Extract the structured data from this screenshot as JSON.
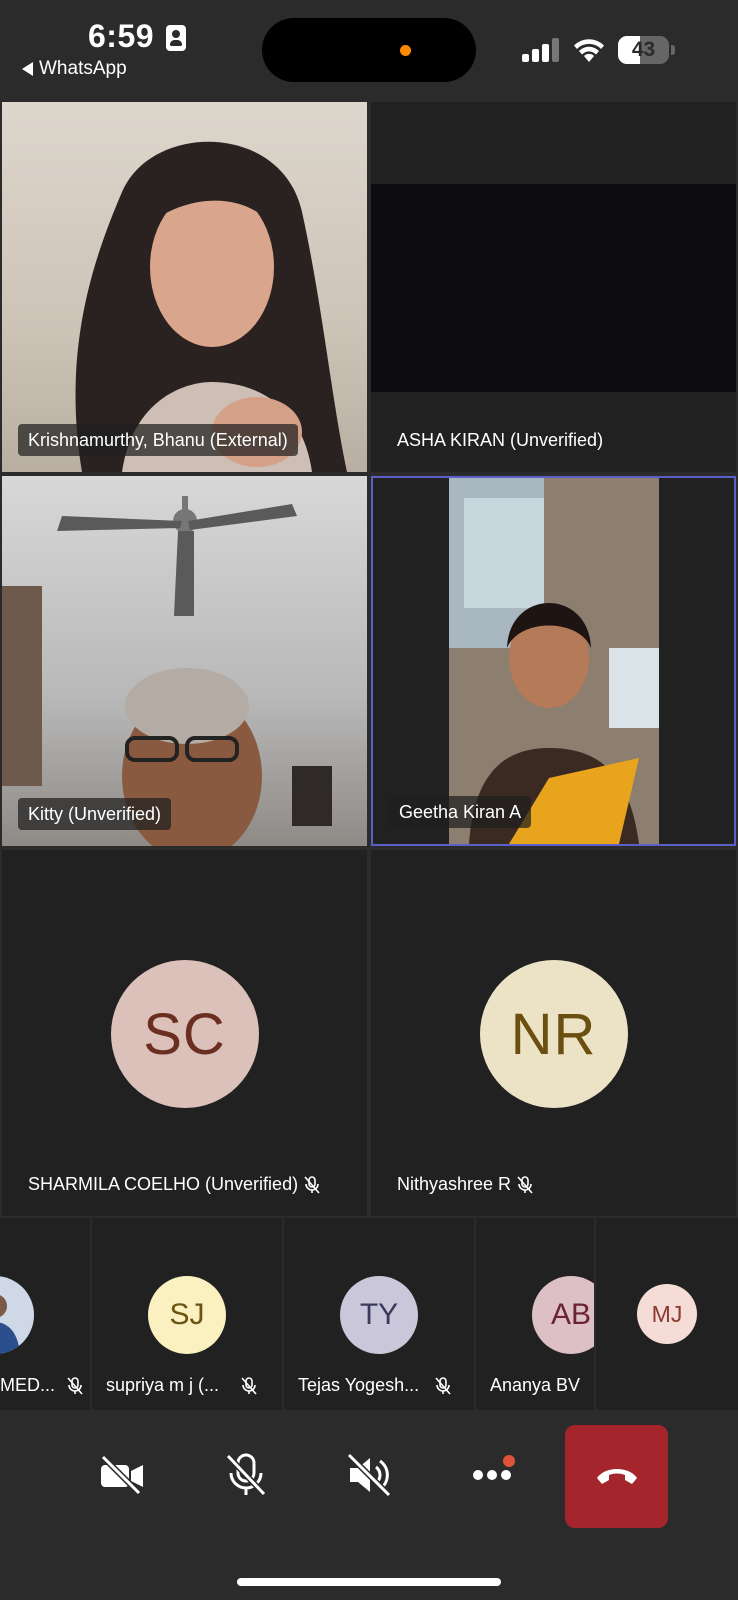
{
  "status_bar": {
    "time": "6:59",
    "back_label": "WhatsApp",
    "battery": "43",
    "battery_level": 0.43
  },
  "grid": [
    {
      "name": "Krishnamurthy, Bhanu (External)",
      "video": true
    },
    {
      "name": "ASHA KIRAN (Unverified)",
      "video": false
    },
    {
      "name": "Kitty (Unverified)",
      "video": true
    },
    {
      "name": "Geetha Kiran A",
      "video": true,
      "active": true
    },
    {
      "name": "SHARMILA COELHO (Unverified)",
      "initials": "SC",
      "muted": true,
      "avatar_bg": "#dcc0ba",
      "avatar_fg": "#6b2f22"
    },
    {
      "name": "Nithyashree R",
      "initials": "NR",
      "muted": true,
      "avatar_bg": "#ece3c6",
      "avatar_fg": "#6b4f10"
    }
  ],
  "strip": [
    {
      "name": "MED...",
      "muted": true
    },
    {
      "name": "supriya m j (...",
      "initials": "SJ",
      "muted": true,
      "avatar_bg": "#fbf0c0",
      "avatar_fg": "#6b5410"
    },
    {
      "name": "Tejas Yogesh...",
      "initials": "TY",
      "muted": true,
      "avatar_bg": "#c9c7d9",
      "avatar_fg": "#3a3a5a"
    },
    {
      "name": "Ananya BV",
      "initials": "AB",
      "muted": false,
      "avatar_bg": "#dcc0c6",
      "avatar_fg": "#6b2333"
    },
    {
      "name": "",
      "initials": "MJ",
      "muted": false,
      "avatar_bg": "#f6dcd6",
      "avatar_fg": "#8a3a30"
    }
  ],
  "controls": {
    "camera": "camera-off-icon",
    "mic": "mic-off-icon",
    "speaker": "speaker-off-icon",
    "more": "more-icon",
    "hangup": "hang-up-icon",
    "hangup_color": "#a4262c",
    "active_tile_border": "#5b5fc7"
  }
}
